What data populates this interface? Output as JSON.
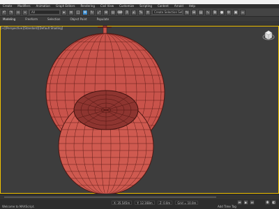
{
  "app": {
    "name": "3ds Max"
  },
  "menu": {
    "items": [
      "Create",
      "Modifiers",
      "Animation",
      "Graph Editors",
      "Rendering",
      "Civil View",
      "Customize",
      "Scripting",
      "Content",
      "Arnold",
      "Help"
    ]
  },
  "toolbar": {
    "selection_filter": "All",
    "named_selection": "Create Selection Set"
  },
  "ribbon": {
    "tabs": [
      "Modeling",
      "Freeform",
      "Selection",
      "Object Paint",
      "Populate"
    ]
  },
  "viewport": {
    "label": "[+][Perspective][Standard][Default Shading]",
    "model_color": "#c9534b",
    "background": "#3d3d3d",
    "border_color": "#f2c200"
  },
  "status": {
    "left_text": "Welcome to MAXScript.",
    "x": "X: 35.545m",
    "y": "Y: 12.168m",
    "z": "Z: 0.0m",
    "grid": "Grid = 10.0m",
    "add_time_tag": "Add Time Tag"
  }
}
